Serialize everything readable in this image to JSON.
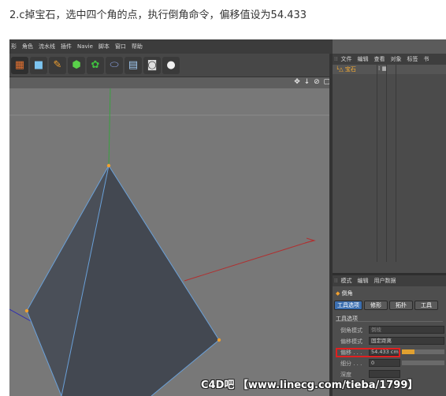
{
  "caption": "2.c掉宝石，选中四个角的点，执行倒角命令，偏移值设为54.433",
  "menu": {
    "items": [
      "形",
      "角色",
      "流水线",
      "插件",
      "Navie",
      "脚本",
      "窗口",
      "帮助"
    ]
  },
  "toolbar": {
    "icons": [
      "clapperboard-icon",
      "cube-icon",
      "pen-icon",
      "subdivision-icon",
      "array-icon",
      "capsule-icon",
      "floor-grid-icon",
      "camera-icon",
      "light-bulb-icon"
    ]
  },
  "viewport": {
    "nav_icons": "✥ ↓ ⊘ ▢"
  },
  "object_manager": {
    "tabs": [
      "文件",
      "编辑",
      "查看",
      "对象",
      "标签",
      "书"
    ],
    "object": {
      "name": "宝石",
      "tags": "⁞ ▦"
    }
  },
  "attribute_manager": {
    "tabs": [
      "模式",
      "编辑",
      "用户数据"
    ],
    "tool_title": "倒角",
    "subtabs": [
      "工具选项",
      "修形",
      "拓扑",
      "工具"
    ],
    "section_title": "工具选项",
    "params": [
      {
        "label": "倒角模式",
        "value": "倒棱"
      },
      {
        "label": "偏移模式",
        "value": "固定距离"
      },
      {
        "label": "偏移 . . .",
        "value": "54.433 cm"
      },
      {
        "label": "细分 . . .",
        "value": "0"
      },
      {
        "label": "深度",
        "value": ""
      }
    ],
    "offset_slider_fraction": 0.3
  },
  "colors": {
    "accent_tab": "#3c6fb0",
    "highlight_box": "#e02020",
    "selected_object": "#ffb030"
  },
  "watermark": "C4D吧 【www.linecg.com/tieba/1799】"
}
